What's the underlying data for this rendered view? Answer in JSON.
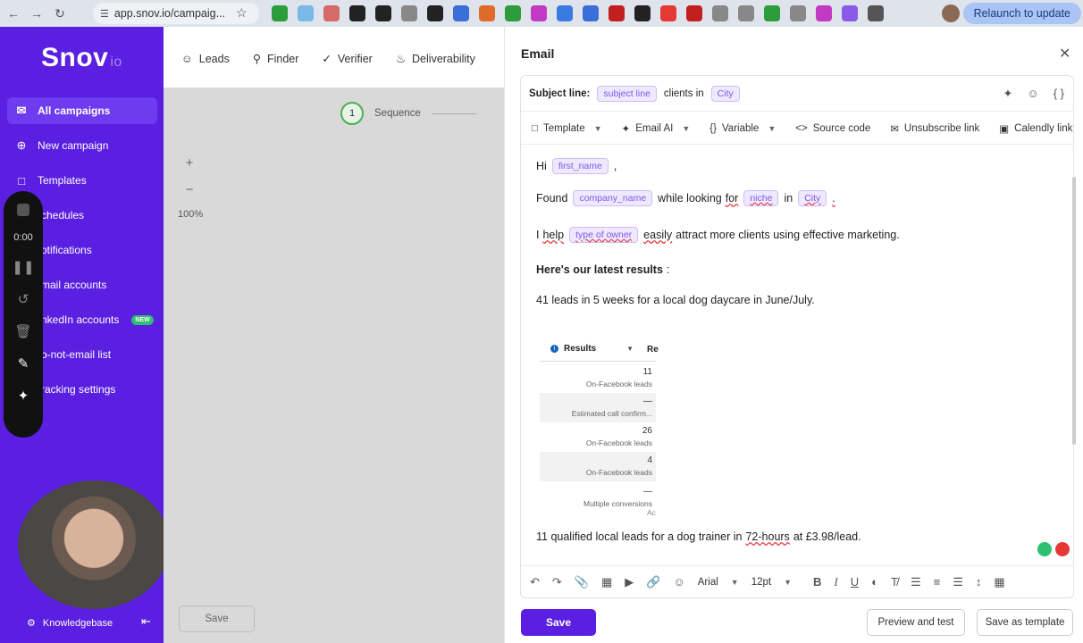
{
  "browser": {
    "url": "app.snov.io/campaig...",
    "relaunch_label": "Relaunch to update",
    "ext_colors": [
      "#2d9d3b",
      "#7ab8e8",
      "#d46a6a",
      "#222",
      "#222",
      "#888",
      "#222",
      "#3b6fd8",
      "#e06a2a",
      "#2d9d3b",
      "#c23ac2",
      "#3b7ae0",
      "#3b6fd8",
      "#c21f1f",
      "#222",
      "#e53935",
      "#c21f1f",
      "#888",
      "#888",
      "#2d9d3b",
      "#888",
      "#c23ac2",
      "#8a5ae8",
      "#555"
    ]
  },
  "sidebar": {
    "logo": "Snov",
    "logo_suffix": "io",
    "items": [
      {
        "label": "All campaigns",
        "icon": "mail-icon"
      },
      {
        "label": "New campaign",
        "icon": "plus-circle-icon"
      },
      {
        "label": "Templates",
        "icon": "folder-icon"
      },
      {
        "label": "chedules",
        "icon": "calendar-icon"
      },
      {
        "label": "otifications",
        "icon": "bell-icon"
      },
      {
        "label": "mail accounts",
        "icon": "mail-icon"
      },
      {
        "label": "nkedIn accounts",
        "icon": "linkedin-icon"
      },
      {
        "label": "o-not-email list",
        "icon": "block-icon"
      },
      {
        "label": "racking settings",
        "icon": "settings-icon"
      }
    ],
    "new_badge": "NEW",
    "knowledgebase": "Knowledgebase"
  },
  "recorder": {
    "time": "0:00"
  },
  "top_nav": [
    "Leads",
    "Finder",
    "Verifier",
    "Deliverability"
  ],
  "canvas": {
    "step_number": "1",
    "step_label": "Sequence",
    "zoom_level": "100%",
    "save_label": "Save"
  },
  "drawer": {
    "title": "Email",
    "subject_label": "Subject line:",
    "subject_chip1": "subject line",
    "subject_text": "clients in",
    "subject_chip2": "City",
    "toolbar": [
      "Template",
      "Email AI",
      "Variable",
      "Source code",
      "Unsubscribe link",
      "Calendly link"
    ],
    "body": {
      "hi": "Hi",
      "first_name": "first_name",
      "comma": ",",
      "found": "Found",
      "company_name": "company_name",
      "while": "while looking",
      "for_word": "for",
      "niche": "niche",
      "in_word": "in",
      "city": "City",
      "period": ".",
      "i_word": "I",
      "help": "help",
      "type_of_owner": "type of owner",
      "easily": "easily",
      "rest_line3": "attract more clients using effective marketing.",
      "heading": "Here's our latest results",
      "heading_colon": ":",
      "leads_line": "41 leads in 5 weeks for a local dog daycare in June/July.",
      "last_line_a": "11 qualified local leads for a dog trainer in",
      "last_line_b": "72-hours",
      "last_line_c": "at £3.98/lead."
    },
    "results": {
      "header": "Results",
      "header_extra": "Re",
      "rows": [
        {
          "value": "11",
          "label": "On-Facebook leads"
        },
        {
          "value": "—",
          "label": "Estimated call confirm..."
        },
        {
          "value": "26",
          "label": "On-Facebook leads"
        },
        {
          "value": "4",
          "label": "On-Facebook leads"
        },
        {
          "value": "—",
          "label": "Multiple conversions"
        }
      ],
      "side_text": "Ac"
    },
    "format_bar": {
      "font": "Arial",
      "size": "12pt"
    },
    "buttons": {
      "save": "Save",
      "preview": "Preview and test",
      "save_template": "Save as template"
    }
  }
}
